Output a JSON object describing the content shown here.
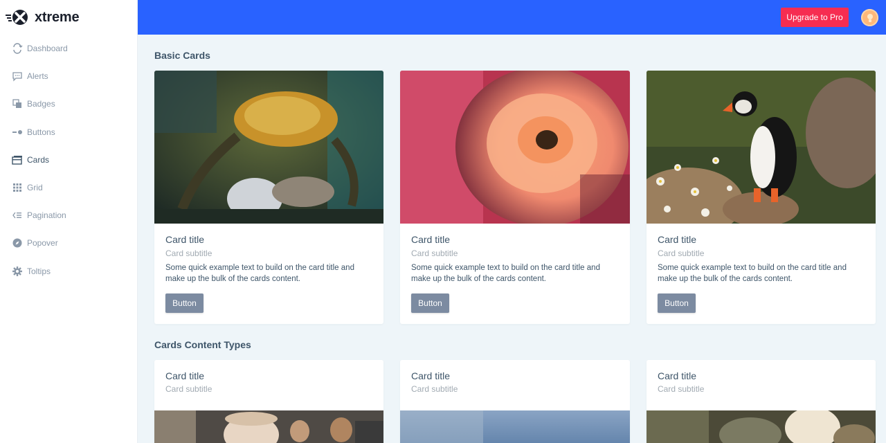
{
  "brand": {
    "name": "xtreme"
  },
  "sidebar": {
    "items": [
      {
        "label": "Dashboard",
        "icon": "dashboard-icon"
      },
      {
        "label": "Alerts",
        "icon": "message-icon"
      },
      {
        "label": "Badges",
        "icon": "copy-icon"
      },
      {
        "label": "Buttons",
        "icon": "toggle-icon"
      },
      {
        "label": "Cards",
        "icon": "cards-icon",
        "active": true
      },
      {
        "label": "Grid",
        "icon": "grid-icon"
      },
      {
        "label": "Pagination",
        "icon": "list-icon"
      },
      {
        "label": "Popover",
        "icon": "compass-icon"
      },
      {
        "label": "Toltips",
        "icon": "gear-icon"
      }
    ]
  },
  "topbar": {
    "upgrade_label": "Upgrade to Pro"
  },
  "colors": {
    "primary": "#2962ff",
    "danger": "#f62d51",
    "button": "#7c8ba1",
    "background": "#eef5f9"
  },
  "sections": {
    "basic": {
      "title": "Basic Cards",
      "cards": [
        {
          "image": "crab-photo",
          "title": "Card title",
          "subtitle": "Card subtitle",
          "text": "Some quick example text to build on the card title and make up the bulk of the cards content.",
          "button": "Button"
        },
        {
          "image": "rose-photo",
          "title": "Card title",
          "subtitle": "Card subtitle",
          "text": "Some quick example text to build on the card title and make up the bulk of the cards content.",
          "button": "Button"
        },
        {
          "image": "puffin-photo",
          "title": "Card title",
          "subtitle": "Card subtitle",
          "text": "Some quick example text to build on the card title and make up the bulk of the cards content.",
          "button": "Button"
        }
      ]
    },
    "content_types": {
      "title": "Cards Content Types",
      "cards": [
        {
          "image": "people-photo",
          "title": "Card title",
          "subtitle": "Card subtitle"
        },
        {
          "image": "sky-photo",
          "title": "Card title",
          "subtitle": "Card subtitle"
        },
        {
          "image": "hands-photo",
          "title": "Card title",
          "subtitle": "Card subtitle"
        }
      ]
    }
  }
}
